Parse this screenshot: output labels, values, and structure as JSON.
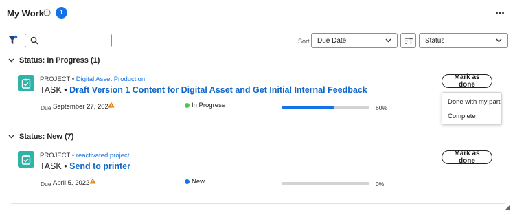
{
  "header": {
    "title": "My Work",
    "badge_count": "1",
    "info_icon": "info-icon",
    "more_icon": "more-horizontal-icon"
  },
  "toolbar": {
    "filter_icon": "filter-icon",
    "search_placeholder": "",
    "search_value": "",
    "sort_label": "Sort",
    "sort_value": "Due Date",
    "sort_order_icon": "sort-order-icon",
    "status_value": "Status"
  },
  "groups": [
    {
      "label": "Status: In Progress (1)",
      "items": [
        {
          "project_prefix": "PROJECT",
          "project_name": "Digital Asset Production",
          "task_prefix": "TASK",
          "task_name": "Draft Version 1 Content for Digital Asset and Get Initial Internal Feedback",
          "due_label": "Due",
          "due_date": "September 27, 2024",
          "status": "In Progress",
          "status_color": "#4bc94b",
          "progress": 0.6,
          "progress_label": "60%",
          "action_label": "Mark as done"
        }
      ]
    },
    {
      "label": "Status: New (7)",
      "items": [
        {
          "project_prefix": "PROJECT",
          "project_name": "reactivated project",
          "task_prefix": "TASK",
          "task_name": "Send to printer",
          "due_label": "Due",
          "due_date": "April 5, 2022",
          "status": "New",
          "status_color": "#1473e6",
          "progress": 0.0,
          "progress_label": "0%",
          "action_label": "Mark as done"
        }
      ]
    }
  ],
  "dropdown_menu": {
    "items": [
      "Done with my part",
      "Complete"
    ]
  },
  "colors": {
    "accent": "#1473e6",
    "task_icon": "#2db3a7",
    "warning": "#e68619",
    "link": "#1167c9"
  }
}
